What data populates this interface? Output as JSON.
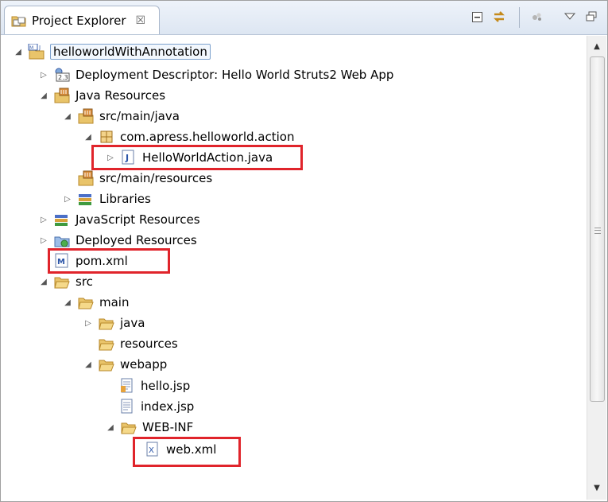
{
  "view": {
    "tab_title": "Project Explorer",
    "tab_close_glyph": "☒",
    "toolbar_icons": [
      "collapse-all-icon",
      "link-with-editor-icon",
      "filter-icon",
      "view-menu-icon",
      "maximize-icon"
    ]
  },
  "tree": {
    "items": [
      {
        "label": "helloworldWithAnnotation",
        "icon": "maven-project-icon",
        "state": "expanded"
      },
      {
        "label": "Deployment Descriptor: Hello World Struts2 Web App",
        "icon": "deployment-descriptor-icon",
        "state": "collapsed"
      },
      {
        "label": "Java Resources",
        "icon": "java-resources-icon",
        "state": "expanded"
      },
      {
        "label": "src/main/java",
        "icon": "source-folder-icon",
        "state": "expanded"
      },
      {
        "label": "com.apress.helloworld.action",
        "icon": "package-icon",
        "state": "expanded"
      },
      {
        "label": "HelloWorldAction.java",
        "icon": "java-file-icon",
        "state": "collapsed"
      },
      {
        "label": "src/main/resources",
        "icon": "source-folder-icon",
        "state": "none"
      },
      {
        "label": "Libraries",
        "icon": "libraries-icon",
        "state": "collapsed"
      },
      {
        "label": "JavaScript Resources",
        "icon": "javascript-resources-icon",
        "state": "collapsed"
      },
      {
        "label": "Deployed Resources",
        "icon": "deployed-resources-icon",
        "state": "collapsed"
      },
      {
        "label": "pom.xml",
        "icon": "maven-pom-icon",
        "state": "none"
      },
      {
        "label": "src",
        "icon": "folder-icon",
        "state": "expanded"
      },
      {
        "label": "main",
        "icon": "folder-icon",
        "state": "expanded"
      },
      {
        "label": "java",
        "icon": "folder-icon",
        "state": "collapsed"
      },
      {
        "label": "resources",
        "icon": "folder-icon",
        "state": "none"
      },
      {
        "label": "webapp",
        "icon": "folder-icon",
        "state": "expanded"
      },
      {
        "label": "hello.jsp",
        "icon": "jsp-file-icon",
        "state": "none"
      },
      {
        "label": "index.jsp",
        "icon": "jsp-file-icon",
        "state": "none"
      },
      {
        "label": "WEB-INF",
        "icon": "folder-icon",
        "state": "expanded"
      },
      {
        "label": "web.xml",
        "icon": "xml-file-icon",
        "state": "none"
      }
    ],
    "highlighted": [
      "HelloWorldAction.java",
      "pom.xml",
      "web.xml"
    ],
    "highlight_color": "#e0242b"
  },
  "scrollbar": {
    "up_glyph": "▲",
    "down_glyph": "▼"
  }
}
